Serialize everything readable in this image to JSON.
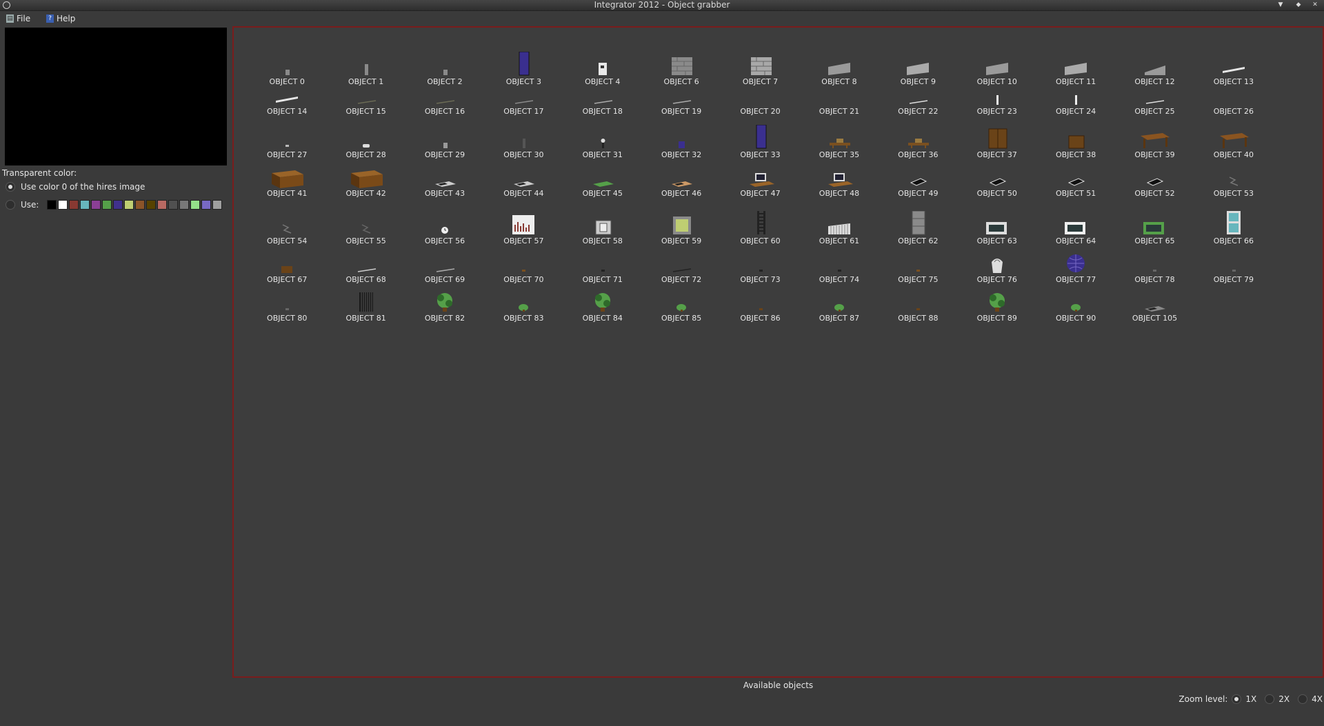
{
  "window": {
    "title": "Integrator 2012 - Object grabber"
  },
  "menu": {
    "file": "File",
    "help": "Help"
  },
  "transparent": {
    "label": "Transparent color:",
    "option_hires": "Use color 0 of the hires image",
    "option_use": "Use:",
    "selected": "option_hires",
    "palette": [
      "#000000",
      "#ffffff",
      "#883932",
      "#67b6bd",
      "#8b3f96",
      "#55a049",
      "#40318d",
      "#bfce72",
      "#8b5429",
      "#574200",
      "#b86962",
      "#505050",
      "#787878",
      "#94e089",
      "#7869c4",
      "#9f9f9f"
    ]
  },
  "objects_caption": "Available objects",
  "zoom": {
    "label": "Zoom level:",
    "options": [
      "1X",
      "2X",
      "4X"
    ],
    "selected": "1X"
  },
  "rows": [
    [
      {
        "name": "OBJECT 0",
        "icon": "small-grey-block-icon",
        "color": "#8a8a8a"
      },
      {
        "name": "OBJECT 1",
        "icon": "grey-post-icon",
        "color": "#8a8a8a"
      },
      {
        "name": "OBJECT 2",
        "icon": "small-grey-block-icon",
        "color": "#8a8a8a"
      },
      {
        "name": "OBJECT 3",
        "icon": "blue-door-icon",
        "color": "#3a2f8f"
      },
      {
        "name": "OBJECT 4",
        "icon": "white-sign-icon",
        "color": "#e8e8e8"
      },
      {
        "name": "OBJECT 6",
        "icon": "brick-wall-icon",
        "color": "#8a8a8a"
      },
      {
        "name": "OBJECT 7",
        "icon": "brick-wall-icon",
        "color": "#a8a8a8"
      },
      {
        "name": "OBJECT 8",
        "icon": "grey-slab-icon",
        "color": "#9a9a9a"
      },
      {
        "name": "OBJECT 9",
        "icon": "grey-slab-icon",
        "color": "#aaaaaa"
      },
      {
        "name": "OBJECT 10",
        "icon": "grey-slab-icon",
        "color": "#9a9a9a"
      },
      {
        "name": "OBJECT 11",
        "icon": "grey-slab-icon",
        "color": "#aaaaaa"
      },
      {
        "name": "OBJECT 12",
        "icon": "grey-wedge-icon",
        "color": "#9a9a9a"
      },
      {
        "name": "OBJECT 13",
        "icon": "white-plank-icon",
        "color": "#e6e6e6"
      }
    ],
    [
      {
        "name": "OBJECT 14",
        "icon": "white-plank-icon",
        "color": "#e6e6e6"
      },
      {
        "name": "OBJECT 15",
        "icon": "thin-line-icon",
        "color": "#6a6a55"
      },
      {
        "name": "OBJECT 16",
        "icon": "thin-line-icon",
        "color": "#6a6a55"
      },
      {
        "name": "OBJECT 17",
        "icon": "thin-line-icon",
        "color": "#8a8a8a"
      },
      {
        "name": "OBJECT 18",
        "icon": "thin-line-icon",
        "color": "#aaaaaa"
      },
      {
        "name": "OBJECT 19",
        "icon": "thin-line-icon",
        "color": "#aaaaaa"
      },
      {
        "name": "OBJECT 20",
        "icon": "empty-icon",
        "color": ""
      },
      {
        "name": "OBJECT 21",
        "icon": "empty-icon",
        "color": ""
      },
      {
        "name": "OBJECT 22",
        "icon": "thin-line-icon",
        "color": "#dddddd"
      },
      {
        "name": "OBJECT 23",
        "icon": "white-post-icon",
        "color": "#eeeeee"
      },
      {
        "name": "OBJECT 24",
        "icon": "white-post-icon",
        "color": "#eeeeee"
      },
      {
        "name": "OBJECT 25",
        "icon": "thin-line-icon",
        "color": "#dddddd"
      },
      {
        "name": "OBJECT 26",
        "icon": "empty-icon",
        "color": ""
      }
    ],
    [
      {
        "name": "OBJECT 27",
        "icon": "tiny-dot-icon",
        "color": "#bbbbbb"
      },
      {
        "name": "OBJECT 28",
        "icon": "small-white-block-icon",
        "color": "#dddddd"
      },
      {
        "name": "OBJECT 29",
        "icon": "small-grey-block-icon",
        "color": "#9a9a9a"
      },
      {
        "name": "OBJECT 30",
        "icon": "dark-post-icon",
        "color": "#555555"
      },
      {
        "name": "OBJECT 31",
        "icon": "lamp-icon",
        "color": "#dddddd"
      },
      {
        "name": "OBJECT 32",
        "icon": "small-blue-block-icon",
        "color": "#3a2f8f"
      },
      {
        "name": "OBJECT 33",
        "icon": "blue-door-icon",
        "color": "#3a2f8f"
      },
      {
        "name": "OBJECT 35",
        "icon": "bench-icon",
        "color": "#7a5020"
      },
      {
        "name": "OBJECT 36",
        "icon": "bench-icon",
        "color": "#7a5020"
      },
      {
        "name": "OBJECT 37",
        "icon": "wardrobe-icon",
        "color": "#6a4318"
      },
      {
        "name": "OBJECT 38",
        "icon": "cabinet-icon",
        "color": "#6a4318"
      },
      {
        "name": "OBJECT 39",
        "icon": "table-icon",
        "color": "#8a5420"
      },
      {
        "name": "OBJECT 40",
        "icon": "table-icon",
        "color": "#8a5420"
      }
    ],
    [
      {
        "name": "OBJECT 41",
        "icon": "desk-icon",
        "color": "#7a4a18"
      },
      {
        "name": "OBJECT 42",
        "icon": "desk-icon",
        "color": "#7a4a18"
      },
      {
        "name": "OBJECT 43",
        "icon": "flat-panel-icon",
        "color": "#cccccc"
      },
      {
        "name": "OBJECT 44",
        "icon": "flat-panel-icon",
        "color": "#cccccc"
      },
      {
        "name": "OBJECT 45",
        "icon": "green-mat-icon",
        "color": "#55a049"
      },
      {
        "name": "OBJECT 46",
        "icon": "flat-panel-icon",
        "color": "#cc9966"
      },
      {
        "name": "OBJECT 47",
        "icon": "computer-icon",
        "color": "#dddddd"
      },
      {
        "name": "OBJECT 48",
        "icon": "computer-icon",
        "color": "#dddddd"
      },
      {
        "name": "OBJECT 49",
        "icon": "black-chair-icon",
        "color": "#111111"
      },
      {
        "name": "OBJECT 50",
        "icon": "black-chair-icon",
        "color": "#111111"
      },
      {
        "name": "OBJECT 51",
        "icon": "black-chair-icon",
        "color": "#111111"
      },
      {
        "name": "OBJECT 52",
        "icon": "black-chair-icon",
        "color": "#111111"
      },
      {
        "name": "OBJECT 53",
        "icon": "sketch-icon",
        "color": "#777777"
      }
    ],
    [
      {
        "name": "OBJECT 54",
        "icon": "sketch-icon",
        "color": "#777777"
      },
      {
        "name": "OBJECT 55",
        "icon": "sketch-icon",
        "color": "#666666"
      },
      {
        "name": "OBJECT 56",
        "icon": "clock-icon",
        "color": "#eeeeee"
      },
      {
        "name": "OBJECT 57",
        "icon": "chart-board-icon",
        "color": "#eeeeee"
      },
      {
        "name": "OBJECT 58",
        "icon": "safe-icon",
        "color": "#cccccc"
      },
      {
        "name": "OBJECT 59",
        "icon": "yellow-box-icon",
        "color": "#bfce72"
      },
      {
        "name": "OBJECT 60",
        "icon": "ladder-icon",
        "color": "#222222"
      },
      {
        "name": "OBJECT 61",
        "icon": "radiator-icon",
        "color": "#dddddd"
      },
      {
        "name": "OBJECT 62",
        "icon": "filing-cabinet-icon",
        "color": "#8a8a8a"
      },
      {
        "name": "OBJECT 63",
        "icon": "picture-frame-icon",
        "color": "#dddddd"
      },
      {
        "name": "OBJECT 64",
        "icon": "picture-frame-icon",
        "color": "#eeeeee"
      },
      {
        "name": "OBJECT 65",
        "icon": "picture-frame-icon",
        "color": "#55a049"
      },
      {
        "name": "OBJECT 66",
        "icon": "window-icon",
        "color": "#67b6bd"
      }
    ],
    [
      {
        "name": "OBJECT 67",
        "icon": "small-brown-box-icon",
        "color": "#6a4318"
      },
      {
        "name": "OBJECT 68",
        "icon": "thin-line-icon",
        "color": "#cccccc"
      },
      {
        "name": "OBJECT 69",
        "icon": "thin-line-icon",
        "color": "#aaaaaa"
      },
      {
        "name": "OBJECT 70",
        "icon": "tiny-dot-icon",
        "color": "#7a5020"
      },
      {
        "name": "OBJECT 71",
        "icon": "tiny-dot-icon",
        "color": "#222222"
      },
      {
        "name": "OBJECT 72",
        "icon": "thin-line-icon",
        "color": "#222222"
      },
      {
        "name": "OBJECT 73",
        "icon": "tiny-dot-icon",
        "color": "#222222"
      },
      {
        "name": "OBJECT 74",
        "icon": "tiny-dot-icon",
        "color": "#222222"
      },
      {
        "name": "OBJECT 75",
        "icon": "tiny-dot-icon",
        "color": "#7a5020"
      },
      {
        "name": "OBJECT 76",
        "icon": "vase-icon",
        "color": "#dddddd"
      },
      {
        "name": "OBJECT 77",
        "icon": "globe-icon",
        "color": "#3a2f8f"
      },
      {
        "name": "OBJECT 78",
        "icon": "tiny-dot-icon",
        "color": "#666666"
      },
      {
        "name": "OBJECT 79",
        "icon": "tiny-dot-icon",
        "color": "#666666"
      }
    ],
    [
      {
        "name": "OBJECT 80",
        "icon": "tiny-dot-icon",
        "color": "#666666"
      },
      {
        "name": "OBJECT 81",
        "icon": "grate-icon",
        "color": "#1a1a1a"
      },
      {
        "name": "OBJECT 82",
        "icon": "plant-icon",
        "color": "#55a049"
      },
      {
        "name": "OBJECT 83",
        "icon": "small-plant-icon",
        "color": "#55a049"
      },
      {
        "name": "OBJECT 84",
        "icon": "plant-icon",
        "color": "#55a049"
      },
      {
        "name": "OBJECT 85",
        "icon": "small-plant-icon",
        "color": "#55a049"
      },
      {
        "name": "OBJECT 86",
        "icon": "tiny-dot-icon",
        "color": "#6a4318"
      },
      {
        "name": "OBJECT 87",
        "icon": "small-plant-icon",
        "color": "#55a049"
      },
      {
        "name": "OBJECT 88",
        "icon": "tiny-dot-icon",
        "color": "#6a4318"
      },
      {
        "name": "OBJECT 89",
        "icon": "plant-icon",
        "color": "#55a049"
      },
      {
        "name": "OBJECT 90",
        "icon": "small-plant-icon",
        "color": "#55a049"
      },
      {
        "name": "OBJECT 105",
        "icon": "flat-panel-icon",
        "color": "#888888"
      }
    ]
  ]
}
